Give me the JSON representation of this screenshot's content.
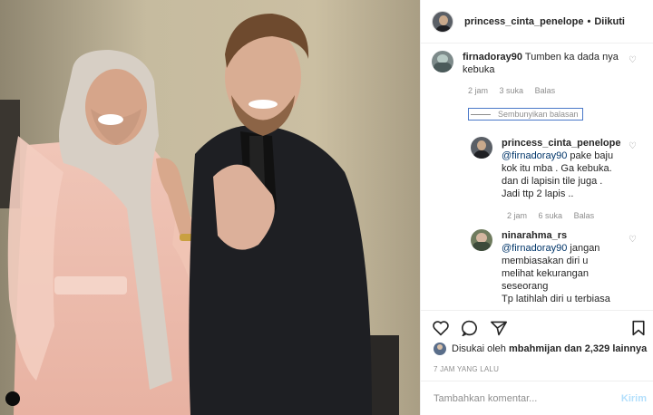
{
  "header": {
    "username": "princess_cinta_penelope",
    "separator": "•",
    "follow_label": "Diikuti"
  },
  "comments": [
    {
      "user": "firnadoray90",
      "text": "Tumben ka dada nya kebuka",
      "time": "2 jam",
      "likes": "3 suka",
      "reply": "Balas"
    },
    {
      "hide_replies": "Sembunyikan balasan"
    },
    {
      "user": "princess_cinta_penelope",
      "mention": "@firnadoray90",
      "text": "pake baju kok itu mba . Ga kebuka. dan di lapisin tile juga . Jadi ttp 2 lapis ..",
      "time": "2 jam",
      "likes": "6 suka",
      "reply": "Balas"
    },
    {
      "user": "ninarahma_rs",
      "mention": "@firnadoray90",
      "text": "jangan membiasakan diri u melihat kekurangan seseorang",
      "text2": "Tp latihlah diri u terbiasa"
    }
  ],
  "likes": {
    "prefix": "Disukai oleh",
    "user": "mbahmijan",
    "rest": "dan 2,329 lainnya"
  },
  "time_ago": "7 JAM YANG LALU",
  "add_comment": {
    "placeholder": "Tambahkan komentar...",
    "send_label": "Kirim"
  },
  "colors": {
    "link": "#003569",
    "send_disabled": "#b2dffc",
    "meta": "#8e8e8e",
    "highlight_border": "#4a78c8"
  },
  "icons": [
    "heart-icon",
    "comment-icon",
    "share-icon",
    "bookmark-icon",
    "carousel-indicator-icon"
  ]
}
